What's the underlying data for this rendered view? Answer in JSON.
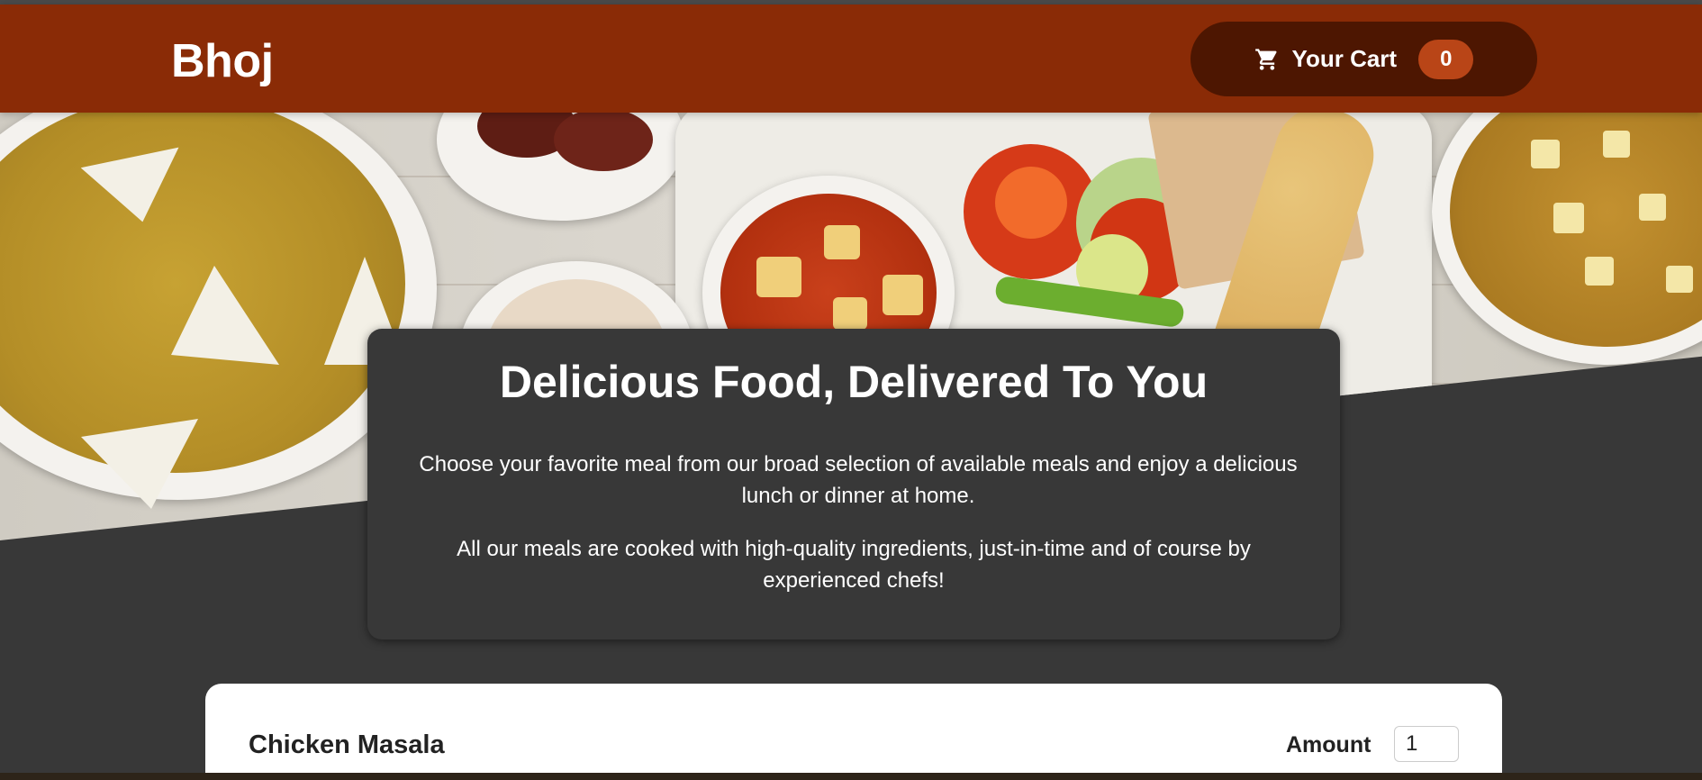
{
  "header": {
    "brand": "Bhoj",
    "cart": {
      "icon": "cart-icon",
      "label": "Your Cart",
      "count": "0"
    }
  },
  "hero": {
    "image": "food-spread-image"
  },
  "intro": {
    "title": "Delicious Food, Delivered To You",
    "paragraph1": "Choose your favorite meal from our broad selection of available meals and enjoy a delicious lunch or dinner at home.",
    "paragraph2": "All our meals are cooked with high-quality ingredients, just-in-time and of course by experienced chefs!"
  },
  "meals": {
    "items": [
      {
        "name": "Chicken Masala",
        "amount_label": "Amount",
        "amount_value": "1"
      }
    ]
  },
  "colors": {
    "header_bg": "#8a2b06",
    "cart_button_bg": "#4d1601",
    "badge_bg": "#b94517",
    "page_bg": "#383838"
  }
}
